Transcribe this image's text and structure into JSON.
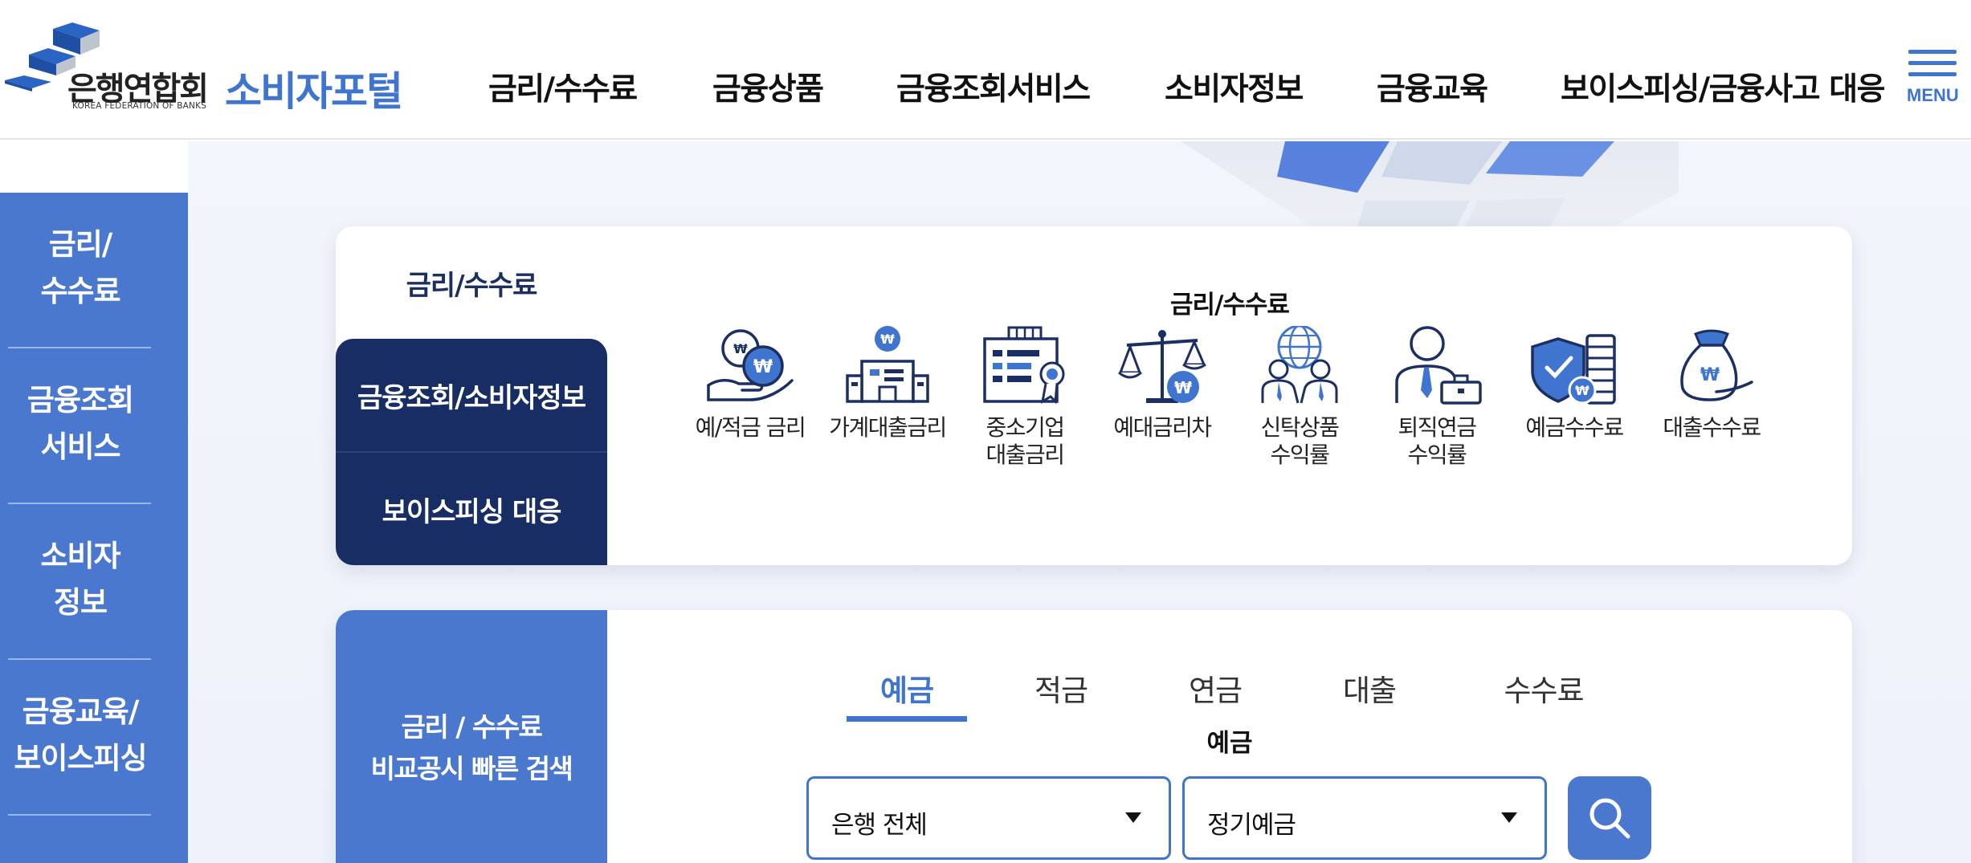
{
  "brand": {
    "logo_name": "은행연합회",
    "logo_sub": "KOREA FEDERATION OF BANKS",
    "portal_title": "소비자포털",
    "accent_color": "#3f74cf",
    "navy_color": "#172d63"
  },
  "gnb": {
    "items": [
      "금리/수수료",
      "금융상품",
      "금융조회서비스",
      "소비자정보",
      "금융교육",
      "보이스피싱/금융사고 대응"
    ],
    "menu_label": "MENU"
  },
  "side_nav": {
    "items": [
      {
        "line1": "금리/",
        "line2": "수수료"
      },
      {
        "line1": "금융조회",
        "line2": "서비스"
      },
      {
        "line1": "소비자",
        "line2": "정보"
      },
      {
        "line1": "금융교육/",
        "line2": "보이스피싱"
      }
    ]
  },
  "category_card": {
    "tabs": [
      "금리/수수료",
      "금융조회/소비자정보",
      "보이스피싱 대응"
    ],
    "title": "금리/수수료",
    "icons": [
      {
        "label": "예/적금 금리",
        "icon": "deposit-rate-icon"
      },
      {
        "label": "가계대출금리",
        "icon": "household-loan-icon"
      },
      {
        "label": "중소기업\n대출금리",
        "icon": "sme-loan-icon"
      },
      {
        "label": "예대금리차",
        "icon": "rate-spread-icon"
      },
      {
        "label": "신탁상품\n수익률",
        "icon": "trust-product-icon"
      },
      {
        "label": "퇴직연금\n수익률",
        "icon": "retirement-pension-icon"
      },
      {
        "label": "예금수수료",
        "icon": "deposit-fee-icon"
      },
      {
        "label": "대출수수료",
        "icon": "loan-fee-icon"
      }
    ]
  },
  "quick_search": {
    "heading_line1": "금리 / 수수료",
    "heading_line2": "비교공시 빠른 검색",
    "tabs": [
      "예금",
      "적금",
      "연금",
      "대출",
      "수수료"
    ],
    "active_tab": "예금",
    "section_title": "예금",
    "bank_select": "은행 전체",
    "product_select": "정기예금"
  }
}
